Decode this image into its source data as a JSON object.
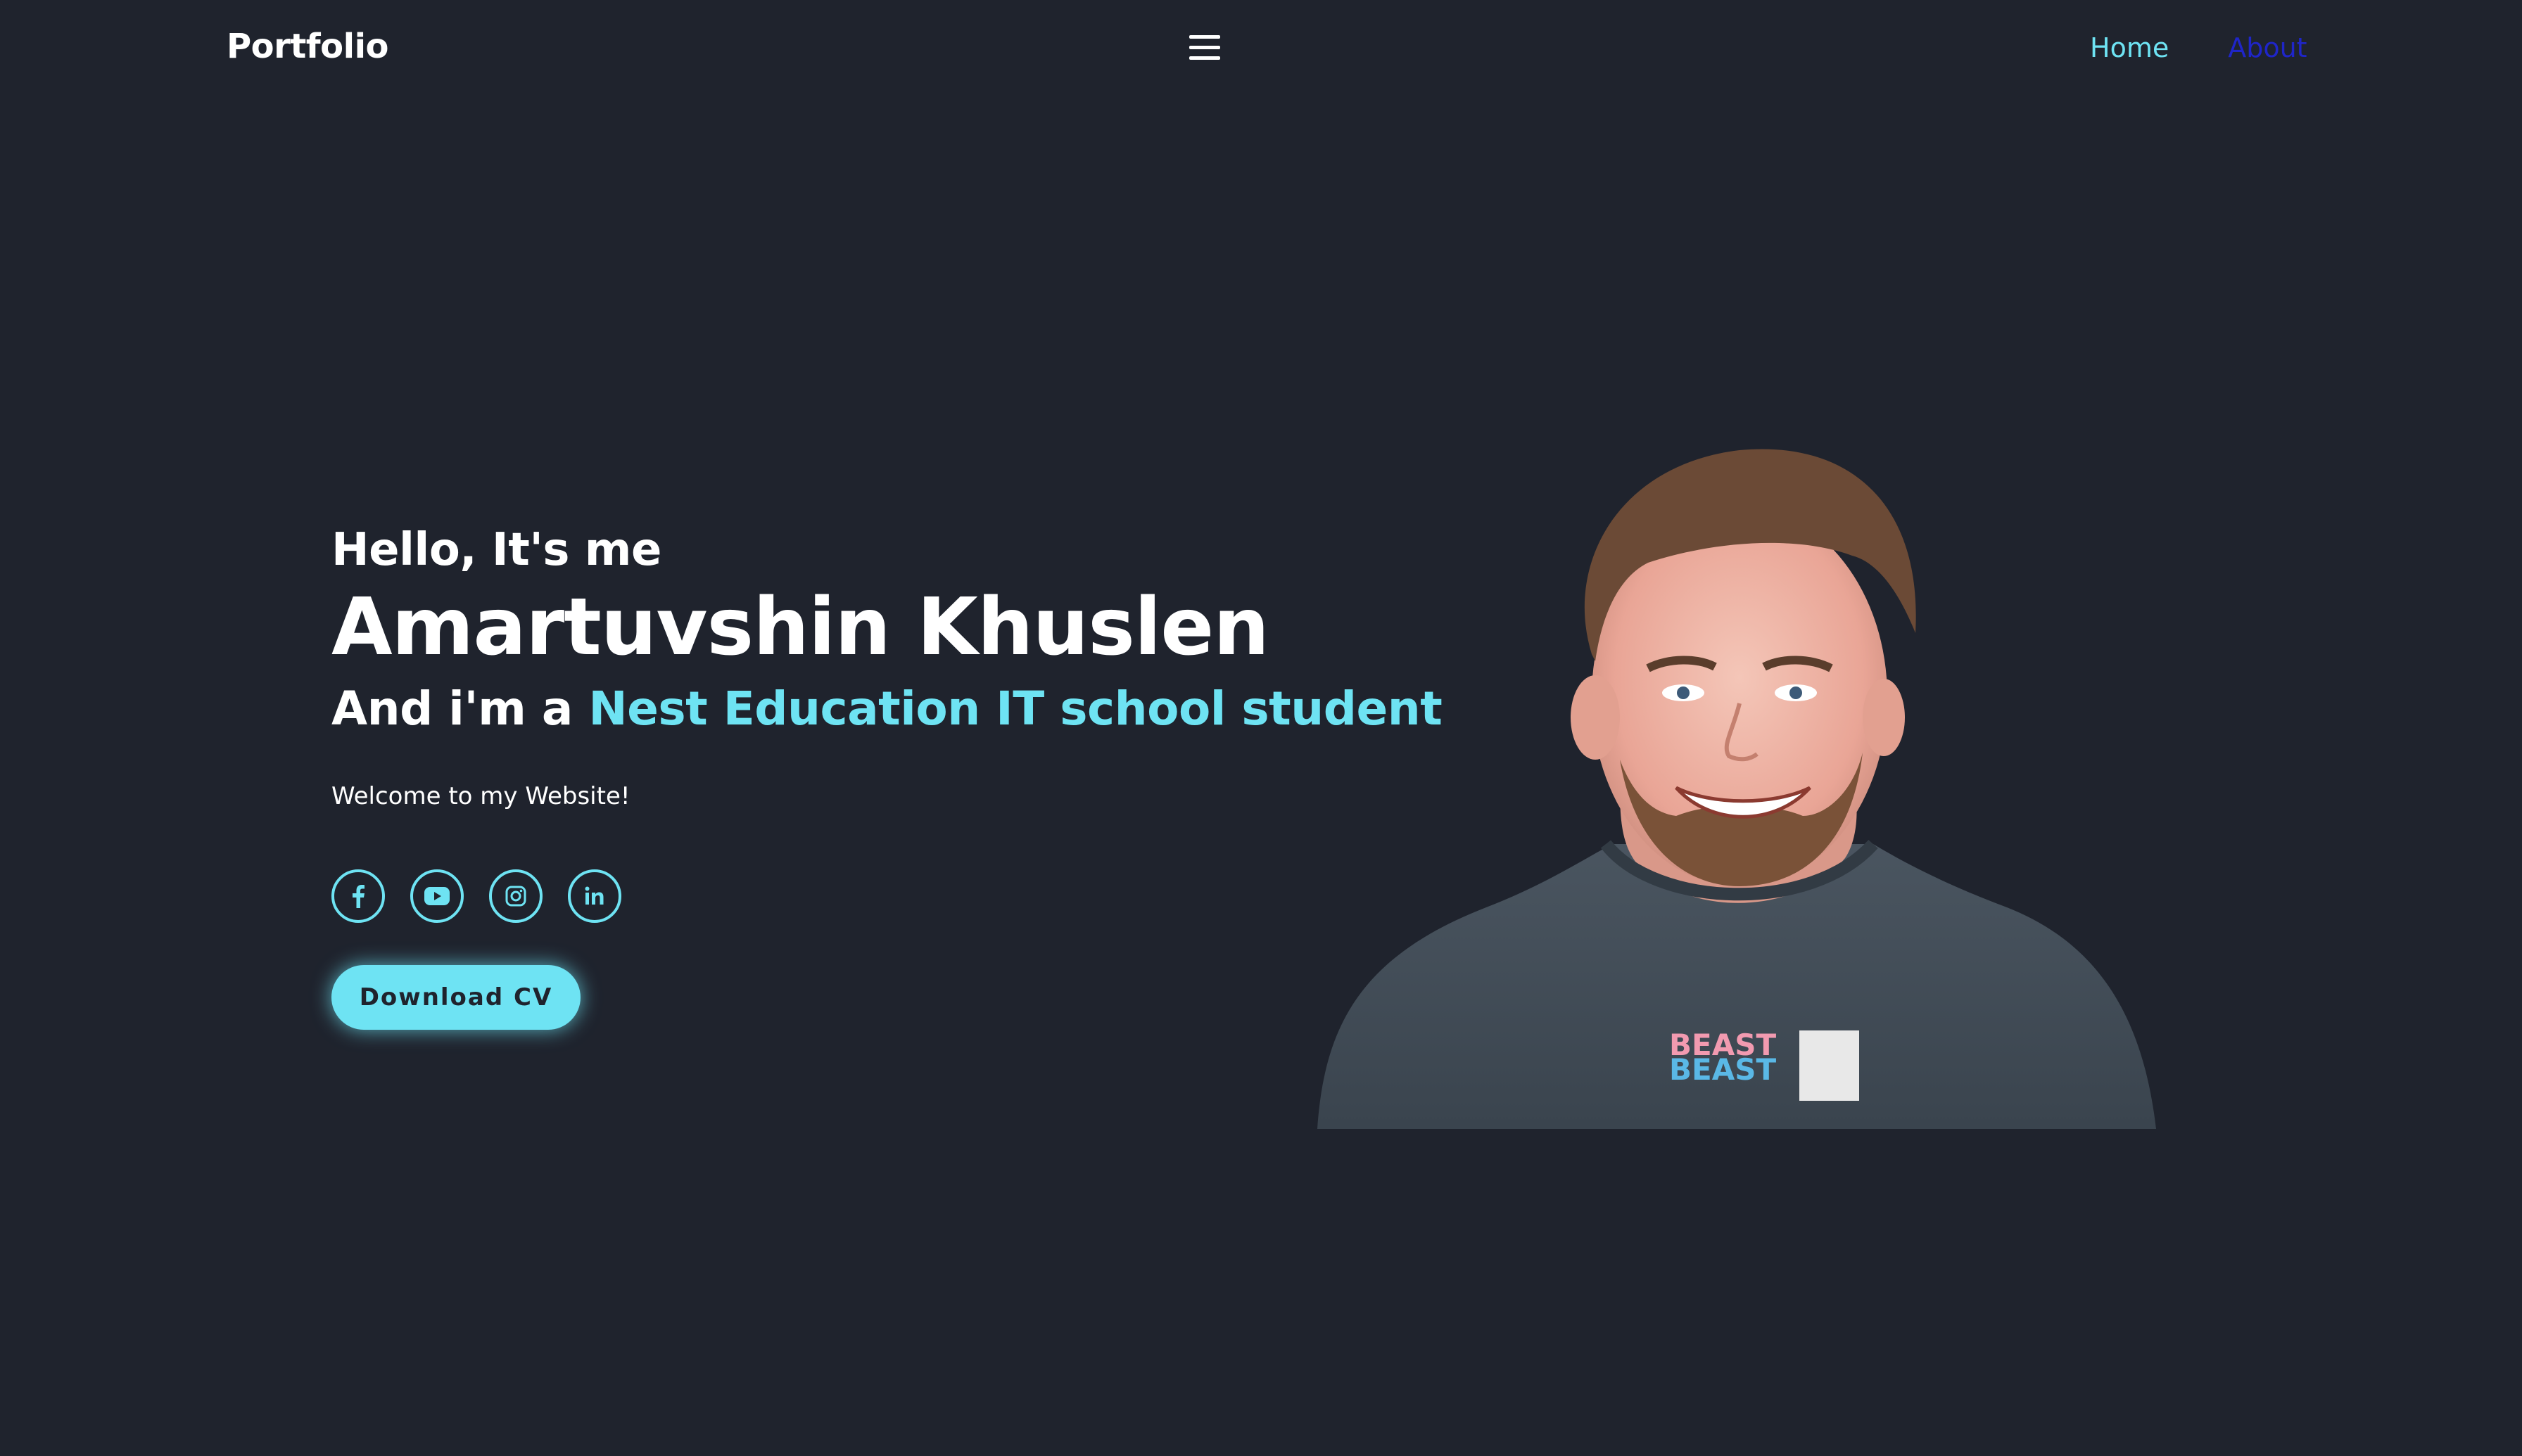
{
  "header": {
    "logo": "Portfolio",
    "menu_icon": "hamburger-menu-icon",
    "nav": [
      {
        "label": "Home",
        "color": "#6ee3f3"
      },
      {
        "label": "About",
        "color": "#1f25c8"
      }
    ]
  },
  "hero": {
    "greeting": "Hello, It's me",
    "name": "Amartuvshin Khuslen",
    "role_prefix": "And i'm a ",
    "role_highlight": "Nest Education IT school student",
    "welcome": "Welcome to my Website!",
    "socials": [
      {
        "icon": "facebook-icon"
      },
      {
        "icon": "youtube-icon"
      },
      {
        "icon": "instagram-icon"
      },
      {
        "icon": "linkedin-icon"
      }
    ],
    "cta_label": "Download CV"
  },
  "colors": {
    "background": "#1f232d",
    "accent": "#6ee3f3",
    "text": "#ffffff"
  }
}
